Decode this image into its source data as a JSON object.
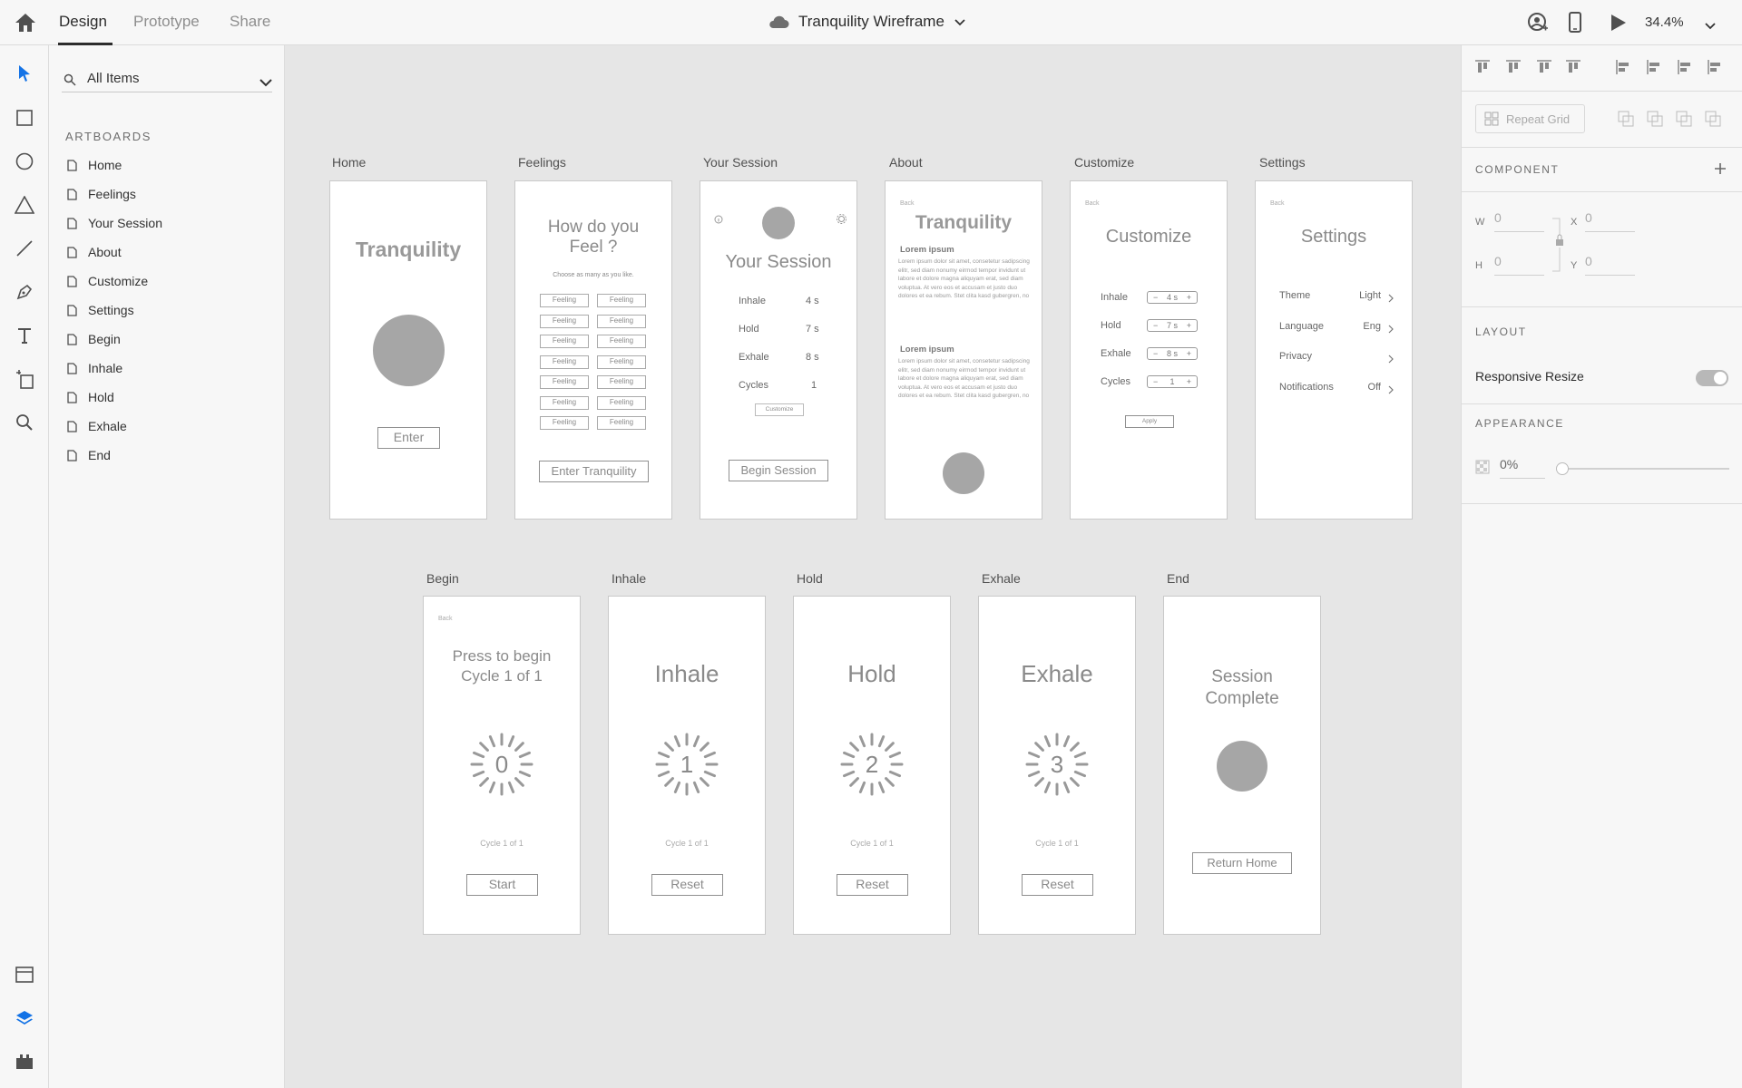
{
  "topbar": {
    "tabs": [
      "Design",
      "Prototype",
      "Share"
    ],
    "doc_title": "Tranquility Wireframe",
    "zoom": "34.4%"
  },
  "layers": {
    "search_text": "All Items",
    "section": "ARTBOARDS",
    "items": [
      "Home",
      "Feelings",
      "Your Session",
      "About",
      "Customize",
      "Settings",
      "Begin",
      "Inhale",
      "Hold",
      "Exhale",
      "End"
    ]
  },
  "artboards": {
    "home": {
      "label": "Home",
      "title": "Tranquility",
      "button": "Enter"
    },
    "feelings": {
      "label": "Feelings",
      "title1": "How do you",
      "title2": "Feel ?",
      "subtitle": "Choose as many as you like.",
      "chip": "Feeling",
      "button": "Enter Tranquility"
    },
    "session": {
      "label": "Your Session",
      "title": "Your Session",
      "rows": [
        {
          "name": "Inhale",
          "value": "4 s"
        },
        {
          "name": "Hold",
          "value": "7 s"
        },
        {
          "name": "Exhale",
          "value": "8 s"
        },
        {
          "name": "Cycles",
          "value": "1"
        }
      ],
      "customize": "Customize",
      "button": "Begin Session"
    },
    "about": {
      "label": "About",
      "back": "Back",
      "title": "Tranquility",
      "heading": "Lorem ipsum",
      "body": "Lorem ipsum dolor sit amet, consetetur sadipscing elitr, sed diam nonumy eirmod tempor invidunt ut labore et dolore magna aliquyam erat, sed diam voluptua. At vero eos et accusam et justo duo dolores et ea rebum. Stet clita kasd gubergren, no"
    },
    "customize": {
      "label": "Customize",
      "back": "Back",
      "title": "Customize",
      "rows": [
        {
          "name": "Inhale",
          "value": "4 s"
        },
        {
          "name": "Hold",
          "value": "7 s"
        },
        {
          "name": "Exhale",
          "value": "8 s"
        },
        {
          "name": "Cycles",
          "value": "1"
        }
      ],
      "minus": "−",
      "plus": "+",
      "apply": "Apply"
    },
    "settings": {
      "label": "Settings",
      "back": "Back",
      "title": "Settings",
      "rows": [
        {
          "name": "Theme",
          "value": "Light"
        },
        {
          "name": "Language",
          "value": "Eng"
        },
        {
          "name": "Privacy",
          "value": ""
        },
        {
          "name": "Notifications",
          "value": "Off"
        }
      ],
      "chevron": ">"
    },
    "begin": {
      "label": "Begin",
      "back": "Back",
      "title1": "Press to begin",
      "title2": "Cycle 1 of 1",
      "number": "0",
      "cycle": "Cycle 1 of 1",
      "button": "Start"
    },
    "inhale": {
      "label": "Inhale",
      "title": "Inhale",
      "number": "1",
      "cycle": "Cycle 1 of 1",
      "button": "Reset"
    },
    "hold": {
      "label": "Hold",
      "title": "Hold",
      "number": "2",
      "cycle": "Cycle 1 of 1",
      "button": "Reset"
    },
    "exhale": {
      "label": "Exhale",
      "title": "Exhale",
      "number": "3",
      "cycle": "Cycle 1 of 1",
      "button": "Reset"
    },
    "end": {
      "label": "End",
      "title1": "Session",
      "title2": "Complete",
      "button": "Return Home"
    }
  },
  "rightpanel": {
    "repeat_grid": "Repeat Grid",
    "component": "COMPONENT",
    "w_label": "W",
    "w_value": "0",
    "h_label": "H",
    "h_value": "0",
    "x_label": "X",
    "x_value": "0",
    "y_label": "Y",
    "y_value": "0",
    "layout": "LAYOUT",
    "responsive_resize": "Responsive Resize",
    "responsive_resize_on": true,
    "appearance": "APPEARANCE",
    "opacity": "0%"
  },
  "colors": {
    "accent": "#1473e6",
    "wireframe_gray": "#a6a6a6"
  }
}
